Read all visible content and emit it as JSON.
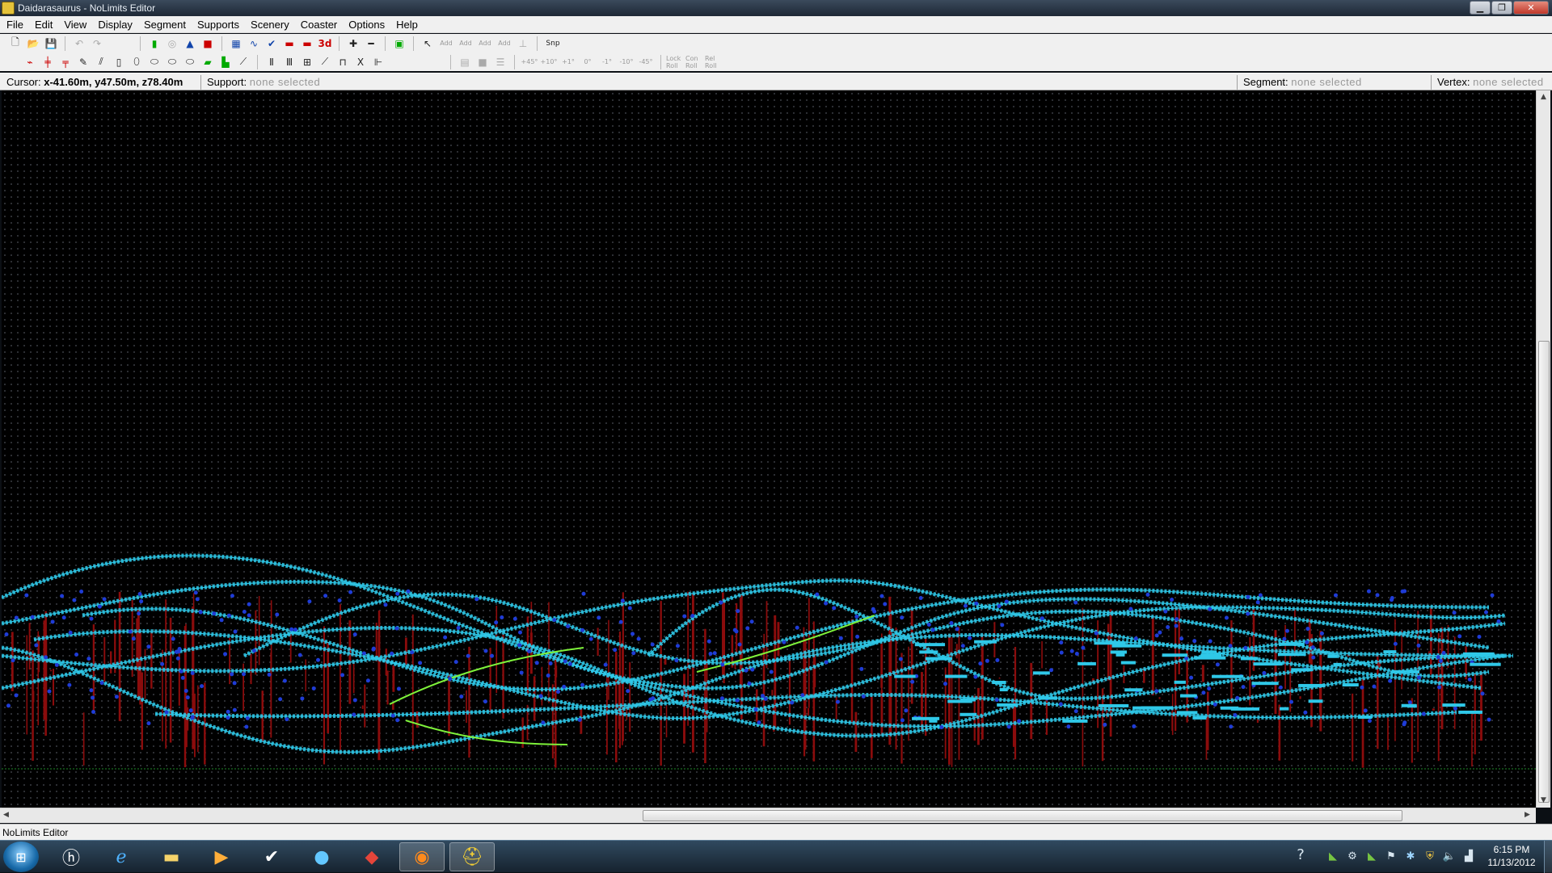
{
  "window": {
    "title": "Daidarasaurus - NoLimits Editor",
    "minimize_icon": "minimize-icon",
    "maximize_icon": "restore-icon",
    "close_icon": "close-icon"
  },
  "menu": [
    "File",
    "Edit",
    "View",
    "Display",
    "Segment",
    "Supports",
    "Scenery",
    "Coaster",
    "Options",
    "Help"
  ],
  "toolbar1": {
    "icons": [
      "new-file-icon",
      "open-folder-icon",
      "save-icon",
      "undo-icon",
      "redo-icon",
      "traffic-light-icon",
      "circle-icon",
      "pyramid-icon",
      "station-icon",
      "grid-icon",
      "wave-icon",
      "check-icon",
      "train-icon",
      "train-alt-icon",
      "3d-view-icon",
      "plus-icon",
      "minus-icon",
      "screen-icon",
      "pointer-icon",
      "add-vertex-icon",
      "add-segment-icon",
      "add-support-icon",
      "add-tree-icon",
      "add-base-icon",
      "snap-icon"
    ],
    "label_3d": "3d",
    "label_add": "Add",
    "label_snp": "Snp"
  },
  "toolbar2": {
    "icons": [
      "track-icon",
      "split-icon",
      "joint-icon",
      "ruler-icon",
      "segment-icon",
      "pillar-icon",
      "footer-1-icon",
      "footer-2-icon",
      "footer-3-icon",
      "footer-4-icon",
      "beam-icon",
      "base-icon",
      "wedge-icon",
      "tower-1-icon",
      "tower-2-icon",
      "tower-3-icon",
      "tower-4-icon",
      "tower-5-icon",
      "tower-6-icon",
      "tower-7-icon",
      "view-1-icon",
      "view-2-icon",
      "view-3-icon"
    ],
    "angles": [
      "+45°",
      "+10°",
      "+1°",
      "0°",
      "-1°",
      "-10°",
      "-45°"
    ],
    "roll_buttons": [
      "Lock Roll",
      "Con Roll",
      "Rel Roll"
    ]
  },
  "statusline": {
    "cursor_label": "Cursor:",
    "cursor_value": "x-41.60m, y47.50m, z78.40m",
    "support_label": "Support:",
    "support_value": "none selected",
    "segment_label": "Segment:",
    "segment_value": "none selected",
    "vertex_label": "Vertex:",
    "vertex_value": "none selected"
  },
  "colors": {
    "track": "#2fc8e8",
    "support": "#8b0c0c",
    "highlight_segment": "#7ef23a",
    "vertex": "#1f3cd6",
    "ground_line": "#1f8a2a"
  },
  "app_status": "NoLimits Editor",
  "taskbar": {
    "start_icon": "windows-start-icon",
    "apps": [
      "hp-icon",
      "internet-explorer-icon",
      "file-explorer-icon",
      "media-player-icon",
      "tasks-icon",
      "blue-orb-icon",
      "red-app-icon",
      "firefox-icon",
      "nolimits-icon"
    ],
    "tray": [
      "help-icon",
      "nvidia-icon",
      "steam-icon",
      "network-icon",
      "flag-icon",
      "bluetooth-icon",
      "shield-icon",
      "volume-icon",
      "signal-icon"
    ],
    "time": "6:15 PM",
    "date": "11/13/2012"
  }
}
